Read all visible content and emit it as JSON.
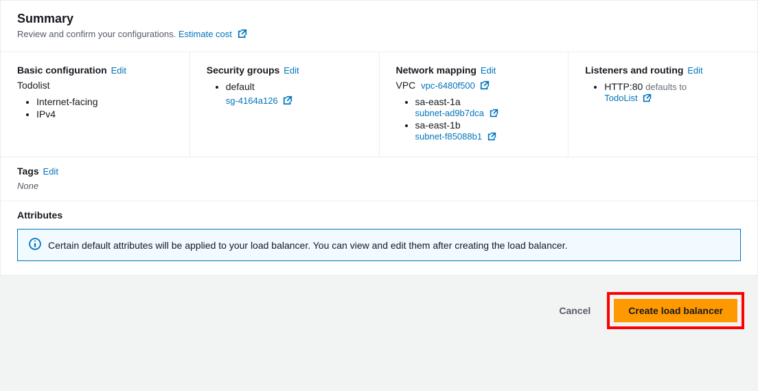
{
  "header": {
    "title": "Summary",
    "subtitle": "Review and confirm your configurations.",
    "estimate": "Estimate cost"
  },
  "edit": "Edit",
  "basic": {
    "heading": "Basic configuration",
    "name": "Todolist",
    "items": [
      "Internet-facing",
      "IPv4"
    ]
  },
  "securityGroups": {
    "heading": "Security groups",
    "items": [
      {
        "label": "default",
        "link": "sg-4164a126"
      }
    ]
  },
  "network": {
    "heading": "Network mapping",
    "vpcLabel": "VPC",
    "vpcLink": "vpc-6480f500",
    "subnets": [
      {
        "az": "sa-east-1a",
        "link": "subnet-ad9b7dca"
      },
      {
        "az": "sa-east-1b",
        "link": "subnet-f85088b1"
      }
    ]
  },
  "listeners": {
    "heading": "Listeners and routing",
    "items": [
      {
        "protocol": "HTTP:80",
        "note": "defaults to",
        "target": "TodoList"
      }
    ]
  },
  "tags": {
    "heading": "Tags",
    "none": "None"
  },
  "attributes": {
    "heading": "Attributes",
    "info": "Certain default attributes will be applied to your load balancer. You can view and edit them after creating the load balancer."
  },
  "footer": {
    "cancel": "Cancel",
    "create": "Create load balancer"
  }
}
